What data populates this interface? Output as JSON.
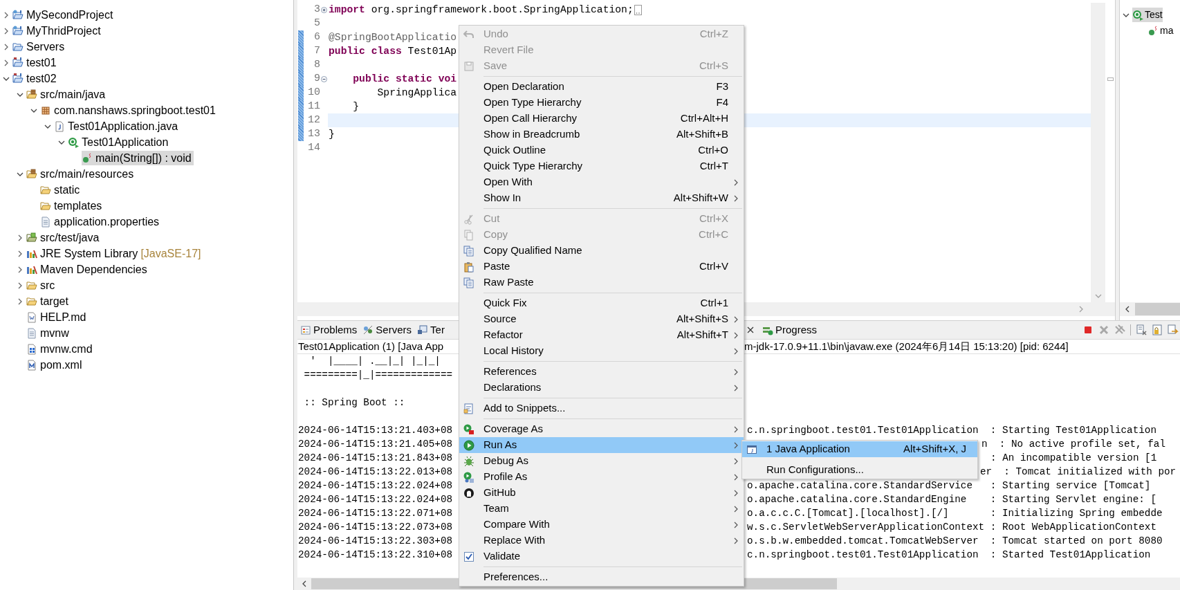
{
  "project_explorer": {
    "items": [
      {
        "label": "MySecondProject",
        "kind": "web-project",
        "expanded": false,
        "selected": false
      },
      {
        "label": "MyThridProject",
        "kind": "web-project",
        "expanded": false,
        "selected": false
      },
      {
        "label": "Servers",
        "kind": "servers-folder",
        "expanded": false,
        "selected": false
      },
      {
        "label": "test01",
        "kind": "maven-project",
        "expanded": false,
        "selected": false
      },
      {
        "label": "test02",
        "kind": "maven-project",
        "expanded": true,
        "selected": false,
        "children": [
          {
            "label": "src/main/java",
            "kind": "source-folder",
            "expanded": true,
            "selected": false,
            "children": [
              {
                "label": "com.nanshaws.springboot.test01",
                "kind": "package",
                "expanded": true,
                "selected": false,
                "children": [
                  {
                    "label": "Test01Application.java",
                    "kind": "java-file",
                    "expanded": true,
                    "selected": false,
                    "children": [
                      {
                        "label": "Test01Application",
                        "kind": "class",
                        "expanded": true,
                        "selected": false,
                        "children": [
                          {
                            "label": "main(String[]) : void",
                            "kind": "method",
                            "selected": true
                          }
                        ]
                      }
                    ]
                  }
                ]
              }
            ]
          },
          {
            "label": "src/main/resources",
            "kind": "source-folder",
            "expanded": true,
            "selected": false,
            "children": [
              {
                "label": "static",
                "kind": "folder",
                "selected": false
              },
              {
                "label": "templates",
                "kind": "folder",
                "selected": false
              },
              {
                "label": "application.properties",
                "kind": "text-file",
                "selected": false
              }
            ]
          },
          {
            "label": "src/test/java",
            "kind": "test-source-folder",
            "expanded": false,
            "selected": false
          },
          {
            "label": "JRE System Library",
            "decoration": "[JavaSE-17]",
            "kind": "library",
            "expanded": false,
            "selected": false
          },
          {
            "label": "Maven Dependencies",
            "kind": "library",
            "expanded": false,
            "selected": false
          },
          {
            "label": "src",
            "kind": "folder",
            "expanded": false,
            "selected": false
          },
          {
            "label": "target",
            "kind": "folder",
            "expanded": false,
            "selected": false
          },
          {
            "label": "HELP.md",
            "kind": "markdown-file",
            "selected": false
          },
          {
            "label": "mvnw",
            "kind": "text-file",
            "selected": false
          },
          {
            "label": "mvnw.cmd",
            "kind": "script-file",
            "selected": false
          },
          {
            "label": "pom.xml",
            "kind": "xml-file",
            "selected": false
          }
        ]
      }
    ]
  },
  "editor": {
    "lines": [
      {
        "number": "3",
        "folded": true,
        "changed": false,
        "current": false,
        "tokens": [
          {
            "kind": "keyword",
            "text": "import"
          },
          {
            "kind": "plain",
            "text": " org.springframework.boot.SpringApplication;"
          }
        ]
      },
      {
        "number": "5",
        "changed": false,
        "current": false
      },
      {
        "number": "6",
        "changed": true,
        "current": false,
        "tokens": [
          {
            "kind": "annotation",
            "text": "@SpringBootApplicatio"
          }
        ]
      },
      {
        "number": "7",
        "changed": true,
        "current": false,
        "tokens": [
          {
            "kind": "keyword",
            "text": "public class"
          },
          {
            "kind": "plain",
            "text": " Test01Ap"
          }
        ]
      },
      {
        "number": "8",
        "changed": true,
        "current": false
      },
      {
        "number": "9",
        "folded": false,
        "changed": true,
        "current": false,
        "tokens": [
          {
            "kind": "keyword",
            "text": "    public static voi"
          }
        ]
      },
      {
        "number": "10",
        "changed": true,
        "current": false,
        "tokens": [
          {
            "kind": "plain",
            "text": "        SpringApplica"
          }
        ]
      },
      {
        "number": "11",
        "changed": true,
        "current": false,
        "tokens": [
          {
            "kind": "plain",
            "text": "    }"
          }
        ]
      },
      {
        "number": "12",
        "changed": true,
        "current": true
      },
      {
        "number": "13",
        "changed": true,
        "current": false,
        "tokens": [
          {
            "kind": "plain",
            "text": "}"
          }
        ]
      },
      {
        "number": "14",
        "changed": false,
        "current": false
      }
    ]
  },
  "outline": {
    "items": [
      {
        "label": "Test",
        "kind": "class",
        "expanded": true,
        "selected": true,
        "children": [
          {
            "label": "ma",
            "kind": "method",
            "selected": false
          }
        ]
      }
    ]
  },
  "bottom_panel": {
    "tabs": [
      {
        "label": "Problems",
        "kind": "problems",
        "selected": false
      },
      {
        "label": "Servers",
        "kind": "servers",
        "selected": false
      },
      {
        "label": "Ter",
        "kind": "terminal",
        "selected": false
      }
    ],
    "progress_tab": {
      "label": "Progress",
      "selected": false
    },
    "console": {
      "header_left": "Test01Application (1) [Java App",
      "header_right": "m-jdk-17.0.9+11.1\\bin\\javaw.exe  (2024年6月14日 15:13:20) [pid: 6244]",
      "banner": [
        "  '  |____| .__|_| |_|_|",
        " =========|_|=============",
        " :: Spring Boot ::"
      ],
      "log": [
        {
          "left": "2024-06-14T15:13:21.403+08",
          "right": "c.n.springboot.test01.Test01Application  : Starting Test01Application"
        },
        {
          "left": "2024-06-14T15:13:21.405+08",
          "right": "n  : No active profile set, fal"
        },
        {
          "left": "2024-06-14T15:13:21.843+08",
          "right": ": An incompatible version [1"
        },
        {
          "left": "2024-06-14T15:13:22.013+08",
          "right": "er  : Tomcat initialized with por"
        },
        {
          "left": "2024-06-14T15:13:22.024+08",
          "right": "o.apache.catalina.core.StandardService   : Starting service [Tomcat]"
        },
        {
          "left": "2024-06-14T15:13:22.024+08",
          "right": "o.apache.catalina.core.StandardEngine    : Starting Servlet engine: ["
        },
        {
          "left": "2024-06-14T15:13:22.071+08",
          "right": "o.a.c.c.C.[Tomcat].[localhost].[/]       : Initializing Spring embedde"
        },
        {
          "left": "2024-06-14T15:13:22.073+08",
          "right": "w.s.c.ServletWebServerApplicationContext : Root WebApplicationContext"
        },
        {
          "left": "2024-06-14T15:13:22.303+08",
          "right": "o.s.b.w.embedded.tomcat.TomcatWebServer  : Tomcat started on port 8080"
        },
        {
          "left": "2024-06-14T15:13:22.310+08",
          "right": "c.n.springboot.test01.Test01Application  : Started Test01Application"
        }
      ]
    }
  },
  "context_menu": {
    "items": [
      {
        "kind": "item",
        "label": "Undo",
        "shortcut": "Ctrl+Z",
        "disabled": true,
        "selected": false,
        "submenu": false
      },
      {
        "kind": "item",
        "label": "Revert File",
        "disabled": true,
        "selected": false,
        "submenu": false
      },
      {
        "kind": "item",
        "label": "Save",
        "shortcut": "Ctrl+S",
        "disabled": true,
        "selected": false,
        "submenu": false
      },
      {
        "kind": "separator"
      },
      {
        "kind": "item",
        "label": "Open Declaration",
        "shortcut": "F3",
        "disabled": false,
        "selected": false,
        "submenu": false
      },
      {
        "kind": "item",
        "label": "Open Type Hierarchy",
        "shortcut": "F4",
        "disabled": false,
        "selected": false,
        "submenu": false
      },
      {
        "kind": "item",
        "label": "Open Call Hierarchy",
        "shortcut": "Ctrl+Alt+H",
        "disabled": false,
        "selected": false,
        "submenu": false
      },
      {
        "kind": "item",
        "label": "Show in Breadcrumb",
        "shortcut": "Alt+Shift+B",
        "disabled": false,
        "selected": false,
        "submenu": false
      },
      {
        "kind": "item",
        "label": "Quick Outline",
        "shortcut": "Ctrl+O",
        "disabled": false,
        "selected": false,
        "submenu": false
      },
      {
        "kind": "item",
        "label": "Quick Type Hierarchy",
        "shortcut": "Ctrl+T",
        "disabled": false,
        "selected": false,
        "submenu": false
      },
      {
        "kind": "item",
        "label": "Open With",
        "disabled": false,
        "selected": false,
        "submenu": true
      },
      {
        "kind": "item",
        "label": "Show In",
        "shortcut": "Alt+Shift+W",
        "disabled": false,
        "selected": false,
        "submenu": true
      },
      {
        "kind": "separator"
      },
      {
        "kind": "item",
        "label": "Cut",
        "shortcut": "Ctrl+X",
        "disabled": true,
        "selected": false,
        "submenu": false
      },
      {
        "kind": "item",
        "label": "Copy",
        "shortcut": "Ctrl+C",
        "disabled": true,
        "selected": false,
        "submenu": false
      },
      {
        "kind": "item",
        "label": "Copy Qualified Name",
        "disabled": false,
        "selected": false,
        "submenu": false
      },
      {
        "kind": "item",
        "label": "Paste",
        "shortcut": "Ctrl+V",
        "disabled": false,
        "selected": false,
        "submenu": false
      },
      {
        "kind": "item",
        "label": "Raw Paste",
        "disabled": false,
        "selected": false,
        "submenu": false
      },
      {
        "kind": "separator"
      },
      {
        "kind": "item",
        "label": "Quick Fix",
        "shortcut": "Ctrl+1",
        "disabled": false,
        "selected": false,
        "submenu": false
      },
      {
        "kind": "item",
        "label": "Source",
        "shortcut": "Alt+Shift+S",
        "disabled": false,
        "selected": false,
        "submenu": true
      },
      {
        "kind": "item",
        "label": "Refactor",
        "shortcut": "Alt+Shift+T",
        "disabled": false,
        "selected": false,
        "submenu": true
      },
      {
        "kind": "item",
        "label": "Local History",
        "disabled": false,
        "selected": false,
        "submenu": true
      },
      {
        "kind": "separator"
      },
      {
        "kind": "item",
        "label": "References",
        "disabled": false,
        "selected": false,
        "submenu": true
      },
      {
        "kind": "item",
        "label": "Declarations",
        "disabled": false,
        "selected": false,
        "submenu": true
      },
      {
        "kind": "separator"
      },
      {
        "kind": "item",
        "label": "Add to Snippets...",
        "disabled": false,
        "selected": false,
        "submenu": false
      },
      {
        "kind": "separator"
      },
      {
        "kind": "item",
        "label": "Coverage As",
        "disabled": false,
        "selected": false,
        "submenu": true
      },
      {
        "kind": "item",
        "label": "Run As",
        "disabled": false,
        "selected": true,
        "submenu": true
      },
      {
        "kind": "item",
        "label": "Debug As",
        "disabled": false,
        "selected": false,
        "submenu": true
      },
      {
        "kind": "item",
        "label": "Profile As",
        "disabled": false,
        "selected": false,
        "submenu": true
      },
      {
        "kind": "item",
        "label": "GitHub",
        "disabled": false,
        "selected": false,
        "submenu": true
      },
      {
        "kind": "item",
        "label": "Team",
        "disabled": false,
        "selected": false,
        "submenu": true
      },
      {
        "kind": "item",
        "label": "Compare With",
        "disabled": false,
        "selected": false,
        "submenu": true
      },
      {
        "kind": "item",
        "label": "Replace With",
        "disabled": false,
        "selected": false,
        "submenu": true
      },
      {
        "kind": "item",
        "label": "Validate",
        "disabled": false,
        "selected": false,
        "submenu": false
      },
      {
        "kind": "separator"
      },
      {
        "kind": "item",
        "label": "Preferences...",
        "disabled": false,
        "selected": false,
        "submenu": false
      }
    ]
  },
  "submenu": {
    "items": [
      {
        "label": "1 Java Application",
        "shortcut": "Alt+Shift+X, J",
        "selected": true
      },
      {
        "label": "Run Configurations...",
        "selected": false
      }
    ]
  }
}
